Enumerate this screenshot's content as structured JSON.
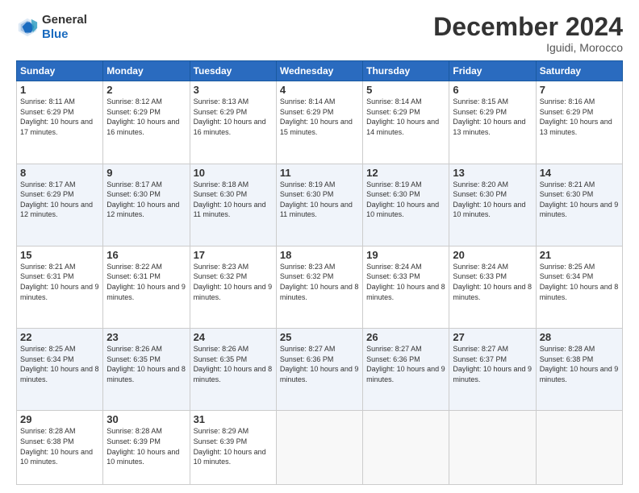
{
  "logo": {
    "line1": "General",
    "line2": "Blue"
  },
  "header": {
    "month": "December 2024",
    "location": "Iguidi, Morocco"
  },
  "weekdays": [
    "Sunday",
    "Monday",
    "Tuesday",
    "Wednesday",
    "Thursday",
    "Friday",
    "Saturday"
  ],
  "weeks": [
    [
      {
        "day": "1",
        "sunrise": "8:11 AM",
        "sunset": "6:29 PM",
        "daylight": "10 hours and 17 minutes."
      },
      {
        "day": "2",
        "sunrise": "8:12 AM",
        "sunset": "6:29 PM",
        "daylight": "10 hours and 16 minutes."
      },
      {
        "day": "3",
        "sunrise": "8:13 AM",
        "sunset": "6:29 PM",
        "daylight": "10 hours and 16 minutes."
      },
      {
        "day": "4",
        "sunrise": "8:14 AM",
        "sunset": "6:29 PM",
        "daylight": "10 hours and 15 minutes."
      },
      {
        "day": "5",
        "sunrise": "8:14 AM",
        "sunset": "6:29 PM",
        "daylight": "10 hours and 14 minutes."
      },
      {
        "day": "6",
        "sunrise": "8:15 AM",
        "sunset": "6:29 PM",
        "daylight": "10 hours and 13 minutes."
      },
      {
        "day": "7",
        "sunrise": "8:16 AM",
        "sunset": "6:29 PM",
        "daylight": "10 hours and 13 minutes."
      }
    ],
    [
      {
        "day": "8",
        "sunrise": "8:17 AM",
        "sunset": "6:29 PM",
        "daylight": "10 hours and 12 minutes."
      },
      {
        "day": "9",
        "sunrise": "8:17 AM",
        "sunset": "6:30 PM",
        "daylight": "10 hours and 12 minutes."
      },
      {
        "day": "10",
        "sunrise": "8:18 AM",
        "sunset": "6:30 PM",
        "daylight": "10 hours and 11 minutes."
      },
      {
        "day": "11",
        "sunrise": "8:19 AM",
        "sunset": "6:30 PM",
        "daylight": "10 hours and 11 minutes."
      },
      {
        "day": "12",
        "sunrise": "8:19 AM",
        "sunset": "6:30 PM",
        "daylight": "10 hours and 10 minutes."
      },
      {
        "day": "13",
        "sunrise": "8:20 AM",
        "sunset": "6:30 PM",
        "daylight": "10 hours and 10 minutes."
      },
      {
        "day": "14",
        "sunrise": "8:21 AM",
        "sunset": "6:30 PM",
        "daylight": "10 hours and 9 minutes."
      }
    ],
    [
      {
        "day": "15",
        "sunrise": "8:21 AM",
        "sunset": "6:31 PM",
        "daylight": "10 hours and 9 minutes."
      },
      {
        "day": "16",
        "sunrise": "8:22 AM",
        "sunset": "6:31 PM",
        "daylight": "10 hours and 9 minutes."
      },
      {
        "day": "17",
        "sunrise": "8:23 AM",
        "sunset": "6:32 PM",
        "daylight": "10 hours and 9 minutes."
      },
      {
        "day": "18",
        "sunrise": "8:23 AM",
        "sunset": "6:32 PM",
        "daylight": "10 hours and 8 minutes."
      },
      {
        "day": "19",
        "sunrise": "8:24 AM",
        "sunset": "6:33 PM",
        "daylight": "10 hours and 8 minutes."
      },
      {
        "day": "20",
        "sunrise": "8:24 AM",
        "sunset": "6:33 PM",
        "daylight": "10 hours and 8 minutes."
      },
      {
        "day": "21",
        "sunrise": "8:25 AM",
        "sunset": "6:34 PM",
        "daylight": "10 hours and 8 minutes."
      }
    ],
    [
      {
        "day": "22",
        "sunrise": "8:25 AM",
        "sunset": "6:34 PM",
        "daylight": "10 hours and 8 minutes."
      },
      {
        "day": "23",
        "sunrise": "8:26 AM",
        "sunset": "6:35 PM",
        "daylight": "10 hours and 8 minutes."
      },
      {
        "day": "24",
        "sunrise": "8:26 AM",
        "sunset": "6:35 PM",
        "daylight": "10 hours and 8 minutes."
      },
      {
        "day": "25",
        "sunrise": "8:27 AM",
        "sunset": "6:36 PM",
        "daylight": "10 hours and 9 minutes."
      },
      {
        "day": "26",
        "sunrise": "8:27 AM",
        "sunset": "6:36 PM",
        "daylight": "10 hours and 9 minutes."
      },
      {
        "day": "27",
        "sunrise": "8:27 AM",
        "sunset": "6:37 PM",
        "daylight": "10 hours and 9 minutes."
      },
      {
        "day": "28",
        "sunrise": "8:28 AM",
        "sunset": "6:38 PM",
        "daylight": "10 hours and 9 minutes."
      }
    ],
    [
      {
        "day": "29",
        "sunrise": "8:28 AM",
        "sunset": "6:38 PM",
        "daylight": "10 hours and 10 minutes."
      },
      {
        "day": "30",
        "sunrise": "8:28 AM",
        "sunset": "6:39 PM",
        "daylight": "10 hours and 10 minutes."
      },
      {
        "day": "31",
        "sunrise": "8:29 AM",
        "sunset": "6:39 PM",
        "daylight": "10 hours and 10 minutes."
      },
      null,
      null,
      null,
      null
    ]
  ]
}
